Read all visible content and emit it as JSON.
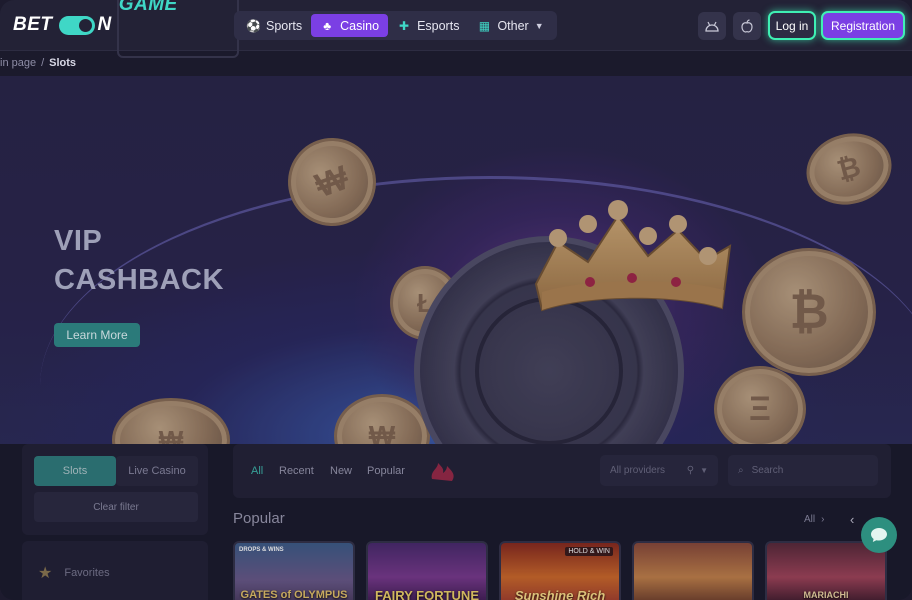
{
  "header": {
    "logo": {
      "left": "BET",
      "right": "GAME"
    },
    "nav": [
      {
        "label": "Sports",
        "icon": "soccer-ball-icon"
      },
      {
        "label": "Casino",
        "icon": "cards-icon",
        "active": true
      },
      {
        "label": "Esports",
        "icon": "gamepad-icon"
      },
      {
        "label": "Other",
        "icon": "grid-icon"
      }
    ],
    "apps": [
      "android-icon",
      "apple-icon"
    ],
    "login_label": "Log in",
    "register_label": "Registration"
  },
  "breadcrumb": {
    "home": "in page",
    "separator": "/",
    "current": "Slots"
  },
  "hero": {
    "title_line1": "VIP",
    "title_line2": "CASHBACK",
    "cta_label": "Learn More"
  },
  "sidebar": {
    "segments": [
      {
        "label": "Slots",
        "active": true
      },
      {
        "label": "Live Casino"
      }
    ],
    "clear_label": "Clear filter",
    "favorites_label": "Favorites"
  },
  "filters": {
    "tabs": [
      "All",
      "Recent",
      "New",
      "Popular"
    ],
    "providers_placeholder": "All providers",
    "search_placeholder": "Search"
  },
  "popular": {
    "title": "Popular",
    "all_label": "All",
    "games": [
      {
        "name": "GATES of OLYMPUS",
        "badge": "DROPS & WINS"
      },
      {
        "name": "FAIRY FORTUNE"
      },
      {
        "name": "Sunshine Rich",
        "badge": "HOLD & WIN"
      },
      {
        "name": ""
      },
      {
        "name": "MARIACHI"
      }
    ]
  },
  "colors": {
    "accent": "#3fd7c6",
    "brand_purple": "#7b3fe4",
    "glow": "#3ff0b4"
  }
}
